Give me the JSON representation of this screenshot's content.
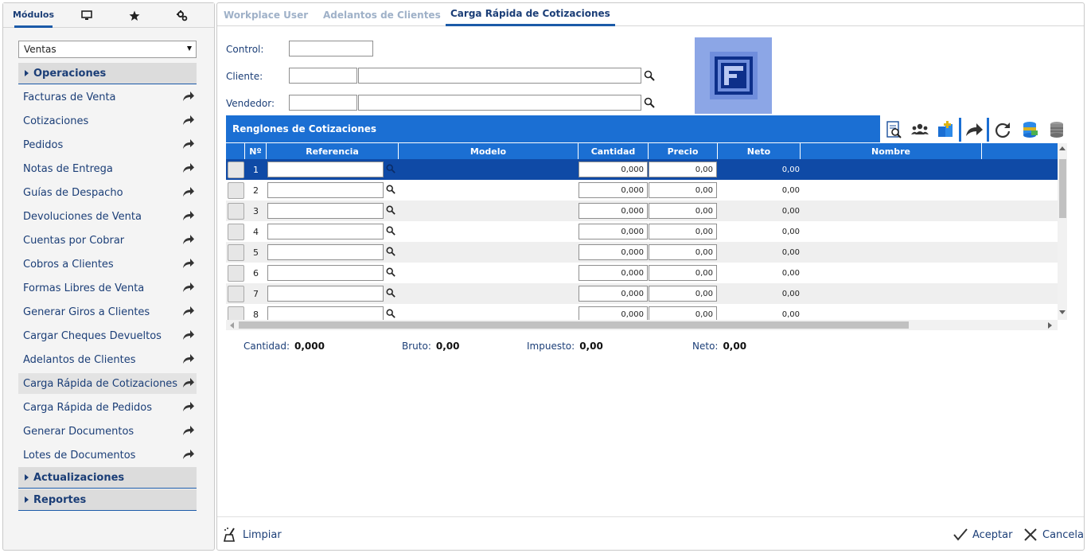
{
  "left": {
    "tabs": {
      "modules_label": "Módulos",
      "desktop_icon": "desktop-icon",
      "favorites_icon": "star-icon",
      "settings_icon": "gears-icon"
    },
    "module_select": {
      "value": "Ventas"
    },
    "sections": {
      "operaciones": "Operaciones",
      "actualizaciones": "Actualizaciones",
      "reportes": "Reportes"
    },
    "items": [
      "Facturas de Venta",
      "Cotizaciones",
      "Pedidos",
      "Notas de Entrega",
      "Guías de Despacho",
      "Devoluciones de Venta",
      "Cuentas por Cobrar",
      "Cobros a Clientes",
      "Formas Libres de Venta",
      "Generar Giros a Clientes",
      "Cargar Cheques Devueltos",
      "Adelantos de Clientes",
      "Carga Rápida de Cotizaciones",
      "Carga Rápida de Pedidos",
      "Generar Documentos",
      "Lotes de Documentos"
    ],
    "active_item": "Carga Rápida de Cotizaciones"
  },
  "tabs": [
    "Workplace User",
    "Adelantos de Clientes",
    "Carga Rápida de Cotizaciones"
  ],
  "form": {
    "control_label": "Control:",
    "cliente_label": "Cliente:",
    "vendedor_label": "Vendedor:"
  },
  "grid": {
    "title": "Renglones de Cotizaciones",
    "columns": [
      "Nº",
      "Referencia",
      "Modelo",
      "Cantidad",
      "Precio",
      "Neto",
      "Nombre"
    ],
    "rows": [
      {
        "n": "1",
        "cantidad": "0,000",
        "precio": "0,00",
        "neto": "0,00"
      },
      {
        "n": "2",
        "cantidad": "0,000",
        "precio": "0,00",
        "neto": "0,00"
      },
      {
        "n": "3",
        "cantidad": "0,000",
        "precio": "0,00",
        "neto": "0,00"
      },
      {
        "n": "4",
        "cantidad": "0,000",
        "precio": "0,00",
        "neto": "0,00"
      },
      {
        "n": "5",
        "cantidad": "0,000",
        "precio": "0,00",
        "neto": "0,00"
      },
      {
        "n": "6",
        "cantidad": "0,000",
        "precio": "0,00",
        "neto": "0,00"
      },
      {
        "n": "7",
        "cantidad": "0,000",
        "precio": "0,00",
        "neto": "0,00"
      },
      {
        "n": "8",
        "cantidad": "0,000",
        "precio": "0,00",
        "neto": "0,00"
      }
    ],
    "toolbar_icons": [
      "document-search-icon",
      "users-icon",
      "add-items-icon",
      "forward-icon",
      "refresh-icon",
      "database-green-icon",
      "database-gray-icon"
    ]
  },
  "totals": {
    "cantidad_label": "Cantidad:",
    "cantidad": "0,000",
    "bruto_label": "Bruto:",
    "bruto": "0,00",
    "impuesto_label": "Impuesto:",
    "impuesto": "0,00",
    "neto_label": "Neto:",
    "neto": "0,00"
  },
  "footer": {
    "limpiar": "Limpiar",
    "aceptar": "Aceptar",
    "cancelar": "Cancelar"
  },
  "colors": {
    "accent": "#1b6fd3",
    "selected_row": "#0f4aa6",
    "text": "#1b3e77",
    "logo_bg": "#8ca6e6"
  }
}
